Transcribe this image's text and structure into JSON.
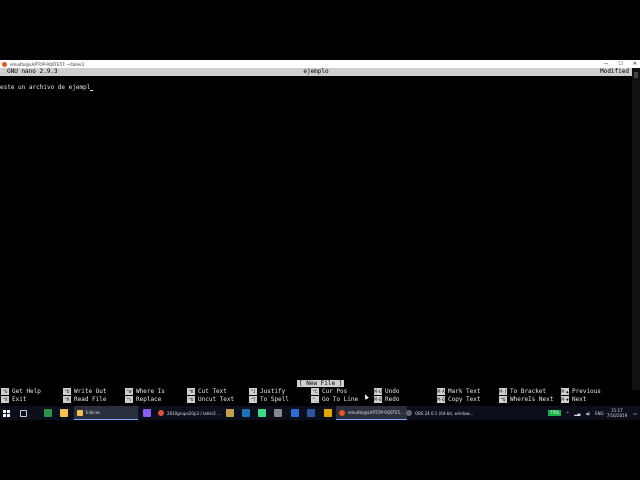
{
  "window": {
    "title": "emu4to@LAPTOP-9Q0TE5T: ~/taller2",
    "controls": [
      "—",
      "☐",
      "✕"
    ]
  },
  "nano": {
    "version": "GNU nano 2.9.3",
    "filename": "ejemplo",
    "modified": "Modified",
    "line": "este un archivo de ejempl",
    "status": "[ New File ]"
  },
  "shortcuts": [
    {
      "key": "^G",
      "label": "Get Help"
    },
    {
      "key": "^O",
      "label": "Write Out"
    },
    {
      "key": "^W",
      "label": "Where Is"
    },
    {
      "key": "^K",
      "label": "Cut Text"
    },
    {
      "key": "^J",
      "label": "Justify"
    },
    {
      "key": "^C",
      "label": "Cur Pos"
    },
    {
      "key": "M-U",
      "label": "Undo"
    },
    {
      "key": "M-A",
      "label": "Mark Text"
    },
    {
      "key": "M-]",
      "label": "To Bracket"
    },
    {
      "key": "M-▲",
      "label": "Previous"
    },
    {
      "key": "^X",
      "label": "Exit"
    },
    {
      "key": "^R",
      "label": "Read File"
    },
    {
      "key": "^\\",
      "label": "Replace"
    },
    {
      "key": "^U",
      "label": "Uncut Text"
    },
    {
      "key": "^T",
      "label": "To Spell"
    },
    {
      "key": "^_",
      "label": "Go To Line"
    },
    {
      "key": "M-E",
      "label": "Redo"
    },
    {
      "key": "M-6",
      "label": "Copy Text"
    },
    {
      "key": "^Q",
      "label": "WhereIs Next"
    },
    {
      "key": "M-▼",
      "label": "Next"
    }
  ],
  "taskbar": {
    "search": "Índices",
    "tasks": [
      {
        "label": "2810grupo20p3 / taller2 ...",
        "color": "#e84b3c",
        "active": false
      },
      {
        "label": "emu4to@LAPTOP-9Q0TE5...",
        "color": "#e95420",
        "active": true
      },
      {
        "label": "OBS 24.0.1 (64-bit, window...",
        "color": "#888888",
        "active": false
      }
    ],
    "battery": "75%",
    "lang": "ENG",
    "time": "21:17",
    "date": "7/16/2019"
  }
}
